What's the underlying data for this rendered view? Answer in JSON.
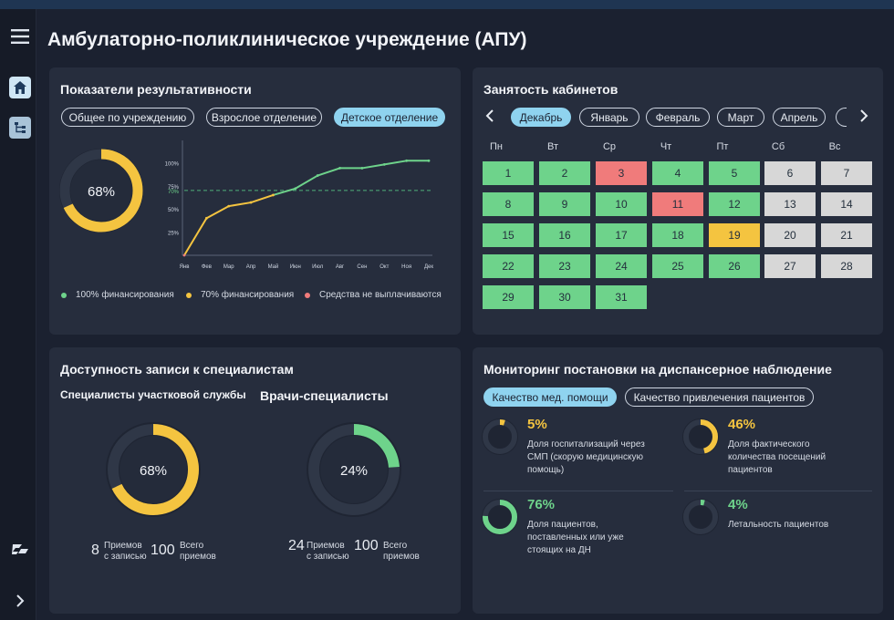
{
  "page_title": "Амбулаторно-поликлиническое учреждение (АПУ)",
  "sidebar": {
    "menu_icon": "menu-icon",
    "home_icon": "home-icon",
    "tree_icon": "org-tree-icon",
    "logo_icon": "logo-icon",
    "expand_icon": "chevron-right-icon"
  },
  "colors": {
    "green": "#6ed38b",
    "yellow": "#f4c440",
    "red": "#f07b7b",
    "grey": "#d7d7d7",
    "accent": "#8fd3ef"
  },
  "performance": {
    "title": "Показатели результативности",
    "tabs": [
      "Общее по учреждению",
      "Взрослое отделение",
      "Детское отделение"
    ],
    "active_tab": 2,
    "donut_value": 0.68,
    "donut_label": "68%",
    "legend": [
      "100% финансирования",
      "70% финансирования",
      "Средства не выплачиваются"
    ],
    "chart_data": {
      "type": "line",
      "categories": [
        "Янв",
        "Фев",
        "Мар",
        "Апр",
        "Май",
        "Июн",
        "Июл",
        "Авг",
        "Сен",
        "Окт",
        "Ноя",
        "Дек"
      ],
      "values": [
        0,
        40,
        53,
        57,
        65,
        72,
        86,
        94,
        94,
        98,
        102,
        102
      ],
      "y_ticks": [
        "100%",
        "75%",
        "70%",
        "50%",
        "25%"
      ],
      "threshold": 70,
      "ylim": [
        0,
        120
      ]
    }
  },
  "cabinets": {
    "title": "Занятость кабинетов",
    "months": [
      "Декабрь",
      "Январь",
      "Февраль",
      "Март",
      "Апрель"
    ],
    "active_month": 0,
    "weekdays": [
      "Пн",
      "Вт",
      "Ср",
      "Чт",
      "Пт",
      "Сб",
      "Вс"
    ],
    "days": [
      {
        "d": "1",
        "s": "g"
      },
      {
        "d": "2",
        "s": "g"
      },
      {
        "d": "3",
        "s": "r"
      },
      {
        "d": "4",
        "s": "g"
      },
      {
        "d": "5",
        "s": "g"
      },
      {
        "d": "6",
        "s": "w"
      },
      {
        "d": "7",
        "s": "w"
      },
      {
        "d": "8",
        "s": "g"
      },
      {
        "d": "9",
        "s": "g"
      },
      {
        "d": "10",
        "s": "g"
      },
      {
        "d": "11",
        "s": "r"
      },
      {
        "d": "12",
        "s": "g"
      },
      {
        "d": "13",
        "s": "w"
      },
      {
        "d": "14",
        "s": "w"
      },
      {
        "d": "15",
        "s": "g"
      },
      {
        "d": "16",
        "s": "g"
      },
      {
        "d": "17",
        "s": "g"
      },
      {
        "d": "18",
        "s": "g"
      },
      {
        "d": "19",
        "s": "y"
      },
      {
        "d": "20",
        "s": "w"
      },
      {
        "d": "21",
        "s": "w"
      },
      {
        "d": "22",
        "s": "g"
      },
      {
        "d": "23",
        "s": "g"
      },
      {
        "d": "24",
        "s": "g"
      },
      {
        "d": "25",
        "s": "g"
      },
      {
        "d": "26",
        "s": "g"
      },
      {
        "d": "27",
        "s": "w"
      },
      {
        "d": "28",
        "s": "w"
      },
      {
        "d": "29",
        "s": "g"
      },
      {
        "d": "30",
        "s": "g"
      },
      {
        "d": "31",
        "s": "g"
      }
    ]
  },
  "availability": {
    "title": "Доступность записи к специалистам",
    "groups": [
      {
        "title": "Специалисты участковой службы",
        "value": 0.68,
        "label": "68%",
        "color": "#f4c440",
        "booked": "8",
        "booked_label1": "Приемов",
        "booked_label2": "с записью",
        "total": "100",
        "total_label1": "Всего",
        "total_label2": "приемов"
      },
      {
        "title": "Врачи-специалисты",
        "value": 0.24,
        "label": "24%",
        "color": "#6ed38b",
        "booked": "24",
        "booked_label1": "Приемов",
        "booked_label2": "с записью",
        "total": "100",
        "total_label1": "Всего",
        "total_label2": "приемов"
      }
    ]
  },
  "monitoring": {
    "title": "Мониторинг постановки на диспансерное наблюдение",
    "tabs": [
      "Качество мед. помощи",
      "Качество привлечения пациентов"
    ],
    "active_tab": 0,
    "items": [
      {
        "pct": "5%",
        "value": 0.05,
        "color": "#f4c440",
        "lines": [
          "Доля госпитализаций через",
          "СМП (скорую медицинскую",
          "помощь)"
        ]
      },
      {
        "pct": "46%",
        "value": 0.46,
        "color": "#f4c440",
        "lines": [
          "Доля фактического",
          "количества посещений",
          "пациентов"
        ]
      },
      {
        "pct": "76%",
        "value": 0.76,
        "color": "#6ed38b",
        "lines": [
          "Доля пациентов,",
          "поставленных или уже",
          "стоящих на ДН"
        ]
      },
      {
        "pct": "4%",
        "value": 0.04,
        "color": "#6ed38b",
        "lines": [
          "Летальность пациентов"
        ]
      }
    ]
  }
}
